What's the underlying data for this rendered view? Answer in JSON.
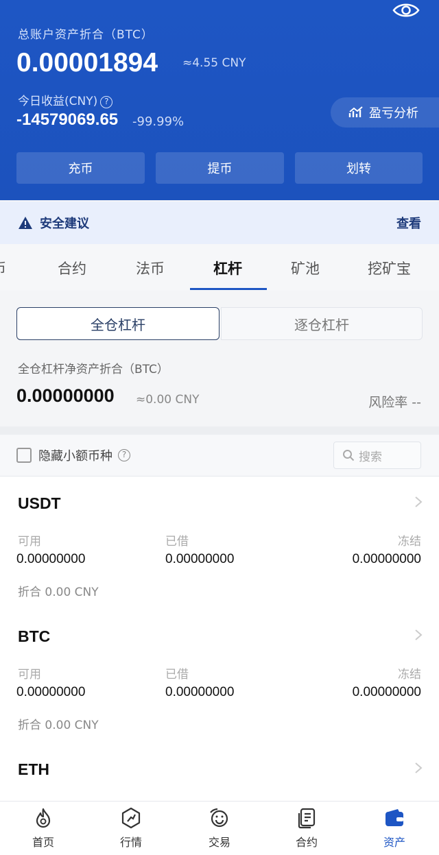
{
  "header": {
    "total_label": "总账户资产折合（BTC）",
    "total_value": "0.00001894",
    "total_cny": "≈4.55 CNY",
    "today_label": "今日收益(CNY)",
    "today_value": "-14579069.65",
    "today_pct": "-99.99%",
    "pnl_button": "盈亏分析",
    "buttons": [
      "充币",
      "提币",
      "划转"
    ],
    "bg_color": "#1e56c4"
  },
  "security": {
    "text": "安全建议",
    "link": "查看"
  },
  "tabs": {
    "items": [
      "币",
      "合约",
      "法币",
      "杠杆",
      "矿池",
      "挖矿宝"
    ],
    "active": "杠杆"
  },
  "segment": {
    "active": "全仓杠杆",
    "inactive": "逐仓杠杆"
  },
  "net": {
    "label": "全仓杠杆净资产折合（BTC）",
    "value": "0.00000000",
    "cny": "≈0.00 CNY",
    "risk": "风险率 --"
  },
  "filter": {
    "hide_small": "隐藏小额币种",
    "search_placeholder": "搜索"
  },
  "coins": [
    {
      "name": "USDT",
      "available_label": "可用",
      "available": "0.00000000",
      "borrowed_label": "已借",
      "borrowed": "0.00000000",
      "frozen_label": "冻结",
      "frozen": "0.00000000",
      "cny": "折合 0.00 CNY"
    },
    {
      "name": "BTC",
      "available_label": "可用",
      "available": "0.00000000",
      "borrowed_label": "已借",
      "borrowed": "0.00000000",
      "frozen_label": "冻结",
      "frozen": "0.00000000",
      "cny": "折合 0.00 CNY"
    },
    {
      "name": "ETH"
    }
  ],
  "bottom_nav": {
    "items": [
      "首页",
      "行情",
      "交易",
      "合约",
      "资产"
    ],
    "active": "资产",
    "accent": "#1e56c4"
  }
}
